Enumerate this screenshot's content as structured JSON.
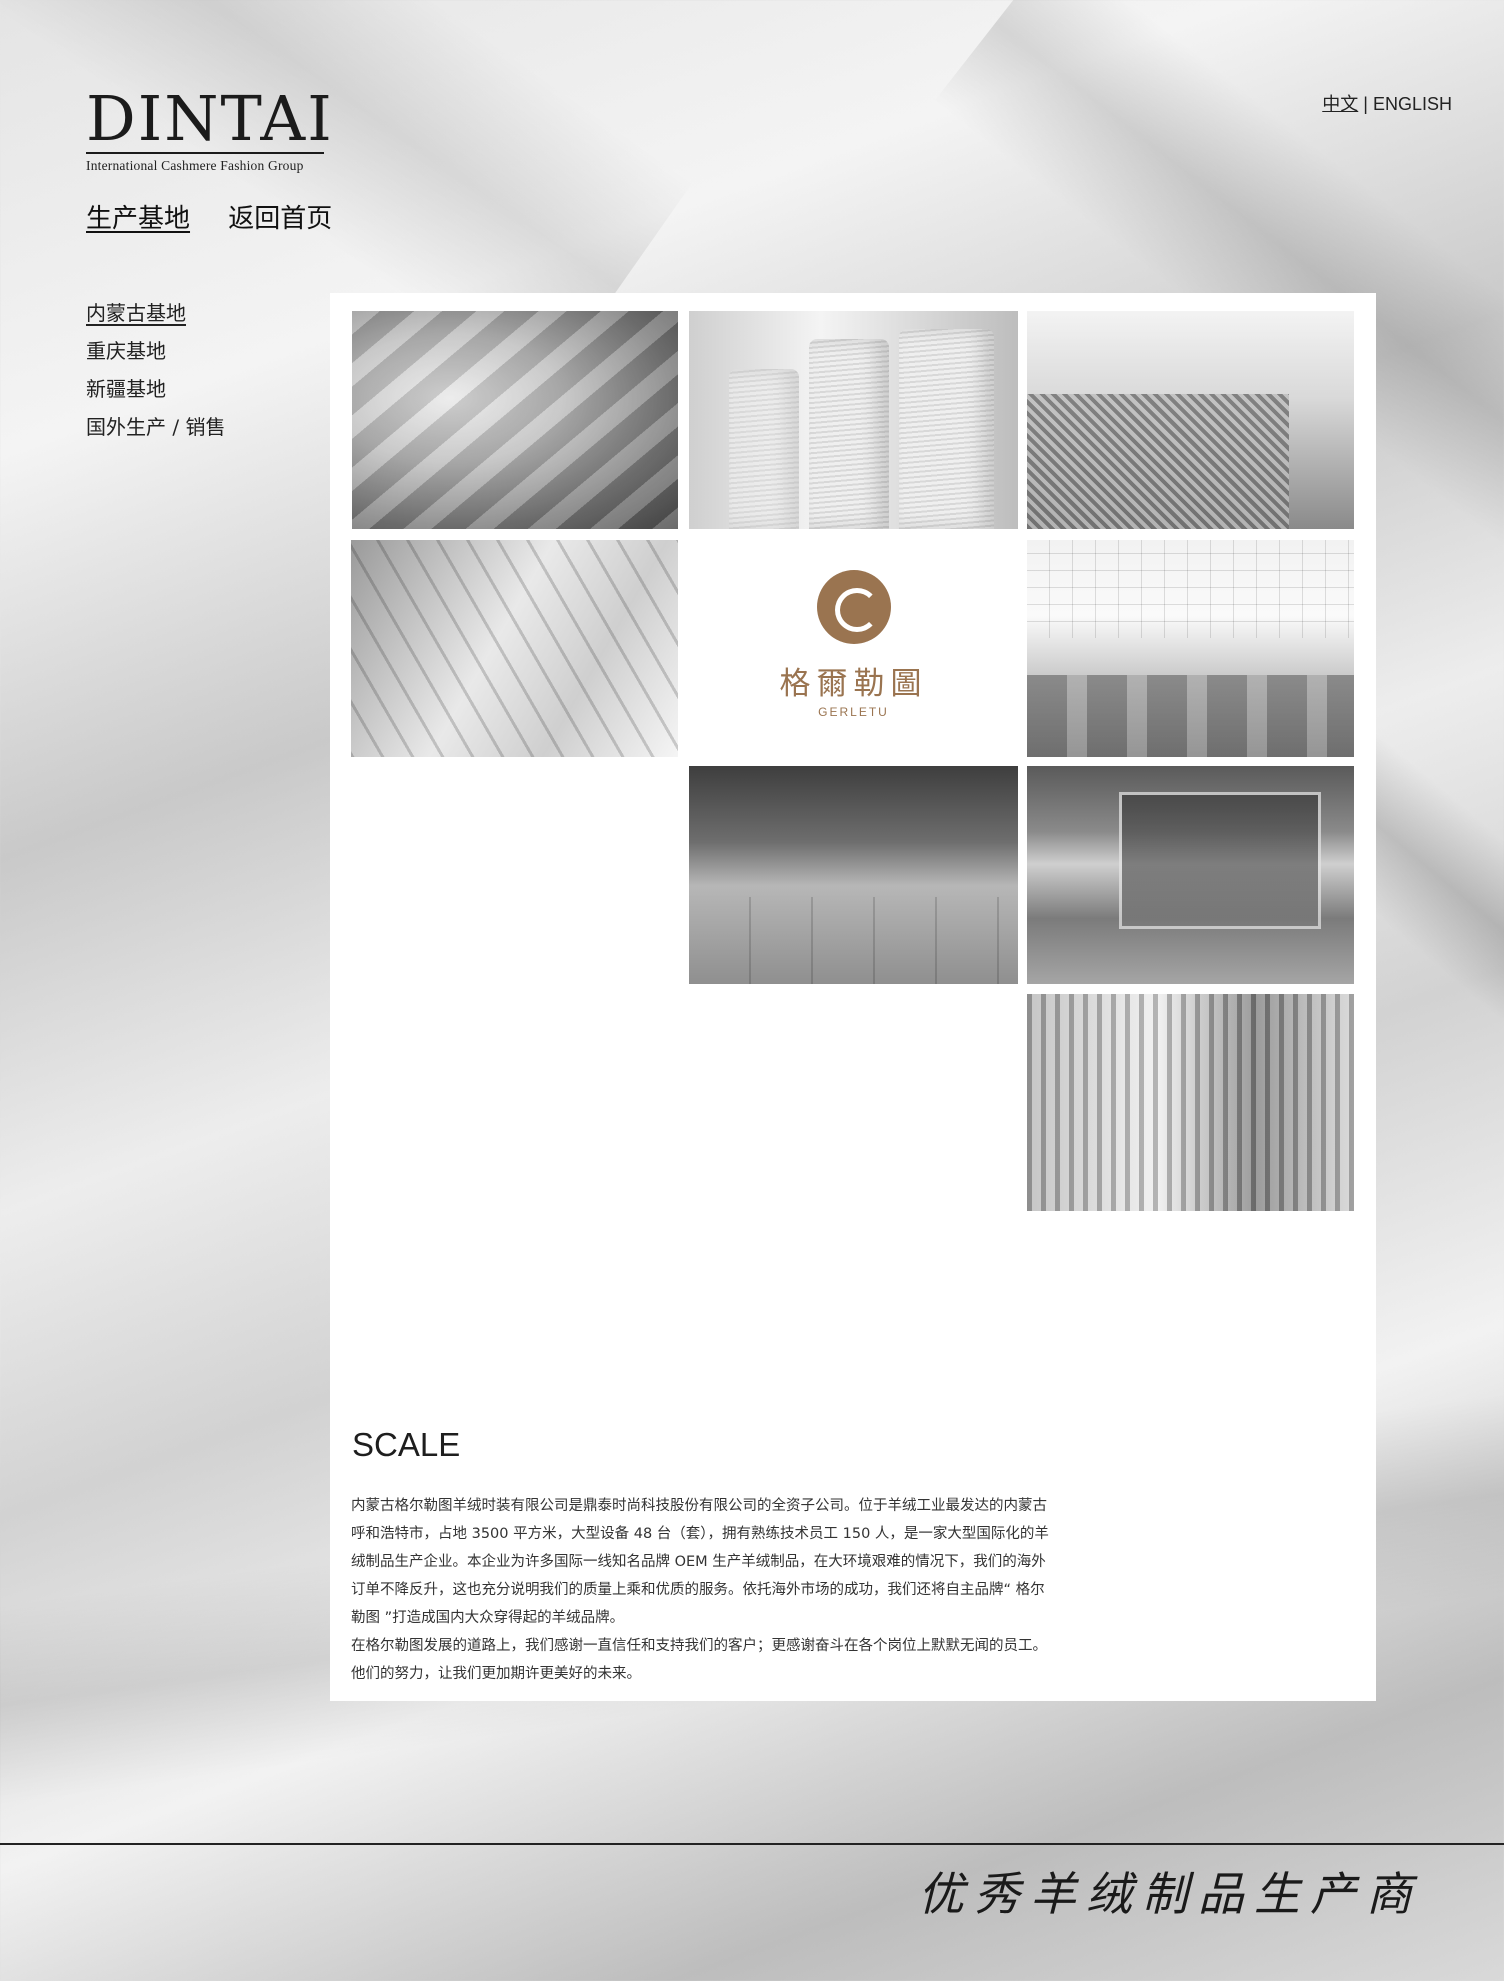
{
  "brand": {
    "name": "DINTAI",
    "tagline": "International Cashmere Fashion Group"
  },
  "language": {
    "current": "中文",
    "separator": "|",
    "other": "ENGLISH"
  },
  "top_nav": {
    "items": [
      {
        "label": "生产基地",
        "active": true
      },
      {
        "label": "返回首页",
        "active": false
      }
    ]
  },
  "side_nav": {
    "items": [
      {
        "label": "内蒙古基地",
        "active": true
      },
      {
        "label": "重庆基地",
        "active": false
      },
      {
        "label": "新疆基地",
        "active": false
      },
      {
        "label": "国外生产 / 销售",
        "active": false
      }
    ]
  },
  "gallery": {
    "brand_tile": {
      "name_cn": "格爾勒圖",
      "name_en": "GERLETU",
      "color": "#9a7450"
    },
    "tiles": [
      "fabric-photo",
      "yarn-spools-photo",
      "sweater-detail-photo",
      "knitting-machine-photo",
      "brand-logo-tile",
      "factory-hall-photo",
      "factory-floor-photo",
      "knitting-machine-floor-photo",
      "needle-bed-photo"
    ]
  },
  "content": {
    "title": "SCALE",
    "paragraphs": [
      "内蒙古格尔勒图羊绒时装有限公司是鼎泰时尚科技股份有限公司的全资子公司。位于羊绒工业最发达的内蒙古呼和浩特市，占地 3500 平方米，大型设备 48 台（套），拥有熟练技术员工 150 人，是一家大型国际化的羊绒制品生产企业。本企业为许多国际一线知名品牌 OEM 生产羊绒制品，在大环境艰难的情况下，我们的海外订单不降反升，这也充分说明我们的质量上乘和优质的服务。依托海外市场的成功，我们还将自主品牌“ 格尔勒图 ”打造成国内大众穿得起的羊绒品牌。",
      "在格尔勒图发展的道路上，我们感谢一直信任和支持我们的客户；更感谢奋斗在各个岗位上默默无闻的员工。他们的努力，让我们更加期许更美好的未来。"
    ]
  },
  "footer": {
    "slogan": "优秀羊绒制品生产商"
  }
}
